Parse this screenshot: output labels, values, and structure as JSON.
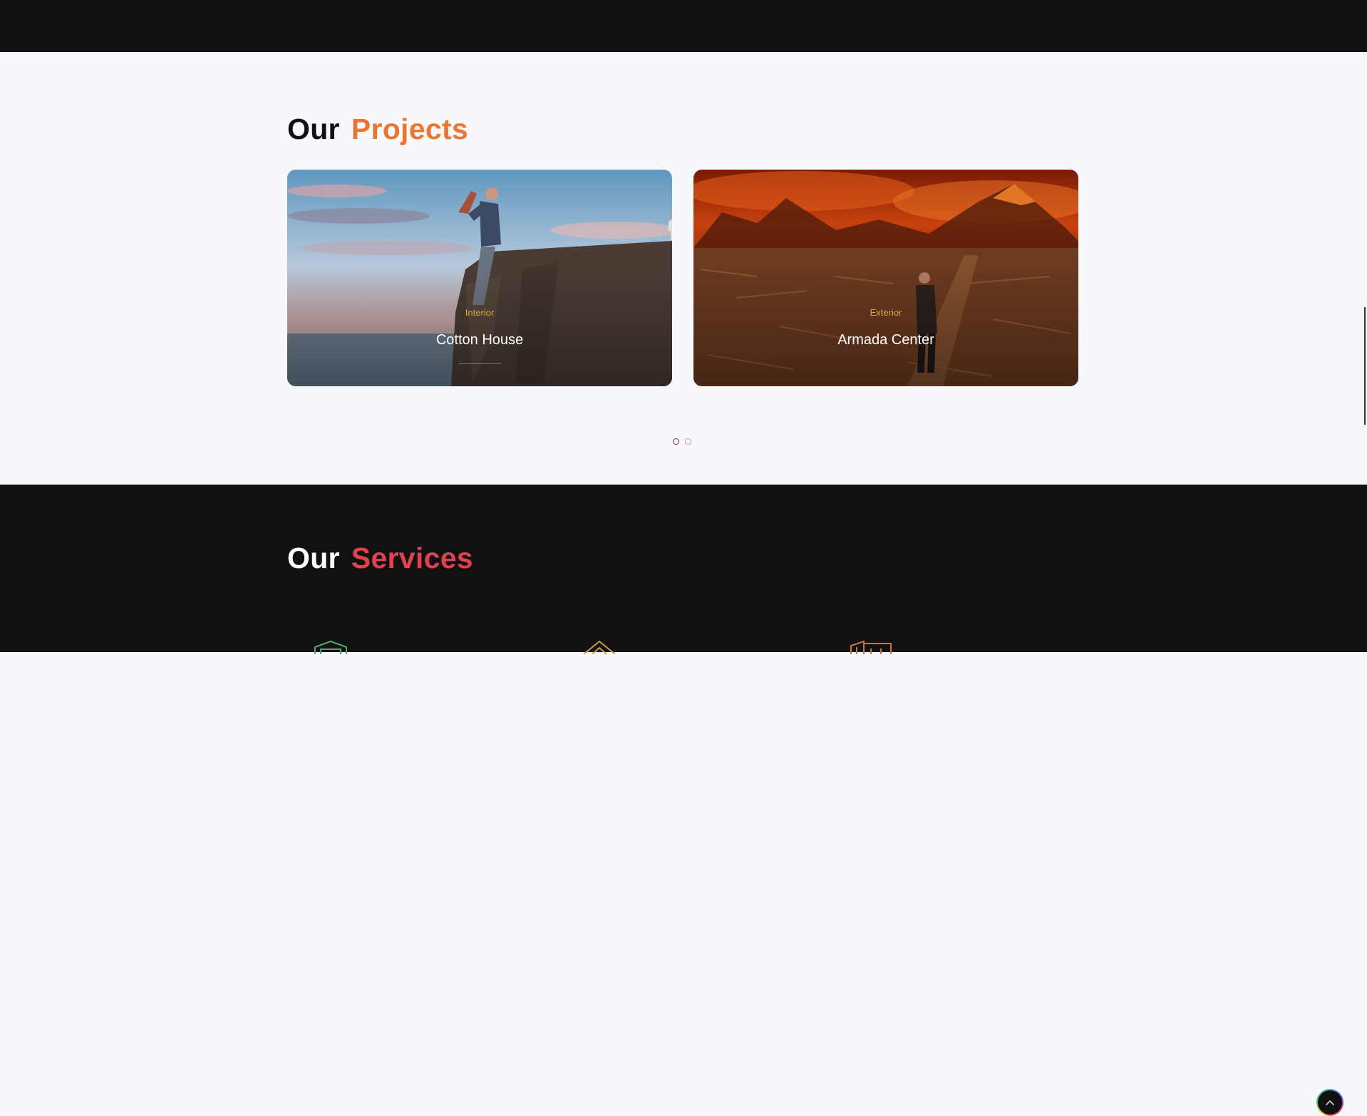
{
  "projects": {
    "heading_part1": "Our",
    "heading_part2": "Projects",
    "cards": [
      {
        "category": "Interior",
        "title": "Cotton House"
      },
      {
        "category": "Exterior",
        "title": "Armada Center"
      }
    ],
    "pagination": {
      "pages": 2,
      "active": 1
    }
  },
  "services": {
    "heading_part1": "Our",
    "heading_part2": "Services",
    "icons": [
      "tower-outline-icon",
      "roof-outline-icon",
      "building-outline-icon"
    ]
  },
  "icons": {
    "back_to_top": "chevron-up-icon"
  },
  "colors": {
    "dark_band": "#111112",
    "page_bg": "#f7f8fc",
    "projects_accent": "#ec7630",
    "services_accent": "#e0424e",
    "category_text": "#d9a441",
    "active_dot": "#8a1f5a"
  }
}
